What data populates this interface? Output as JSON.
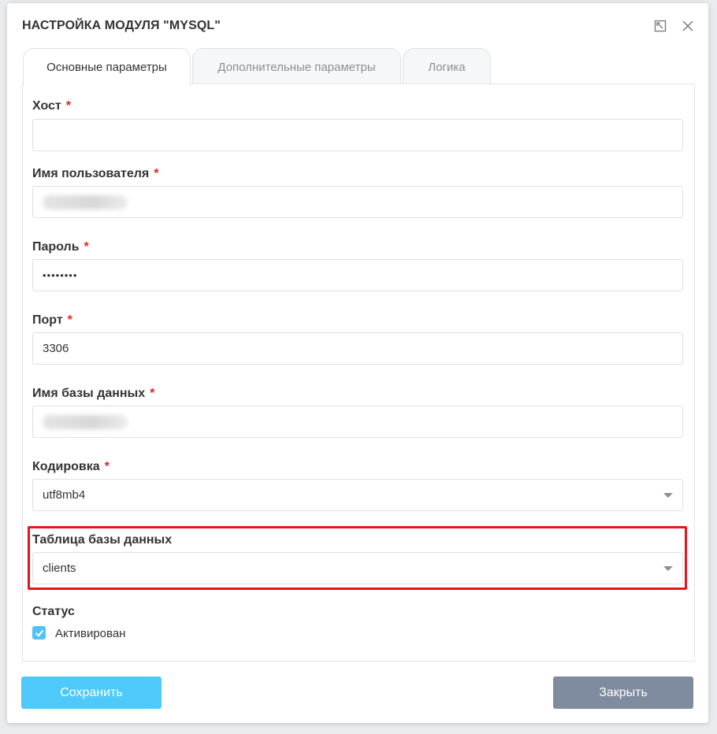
{
  "dialog": {
    "title": "НАСТРОЙКА МОДУЛЯ \"MYSQL\""
  },
  "tabs": [
    {
      "label": "Основные параметры",
      "active": true
    },
    {
      "label": "Дополнительные параметры",
      "active": false
    },
    {
      "label": "Логика",
      "active": false
    }
  ],
  "form": {
    "required_mark": "*",
    "host": {
      "label": "Хост",
      "value": ""
    },
    "username": {
      "label": "Имя пользователя",
      "value": ""
    },
    "password": {
      "label": "Пароль",
      "value": "••••••••"
    },
    "port": {
      "label": "Порт",
      "value": "3306"
    },
    "dbname": {
      "label": "Имя базы данных",
      "value": ""
    },
    "encoding": {
      "label": "Кодировка",
      "value": "utf8mb4"
    },
    "table": {
      "label": "Таблица базы данных",
      "value": "clients"
    },
    "status": {
      "label": "Статус",
      "checkbox_label": "Активирован",
      "checked": true
    }
  },
  "buttons": {
    "save": "Сохранить",
    "close": "Закрыть"
  },
  "colors": {
    "accent": "#4fc9fa",
    "required": "#e02020",
    "highlight": "#e8141c",
    "close_button": "#7f8b9f"
  }
}
